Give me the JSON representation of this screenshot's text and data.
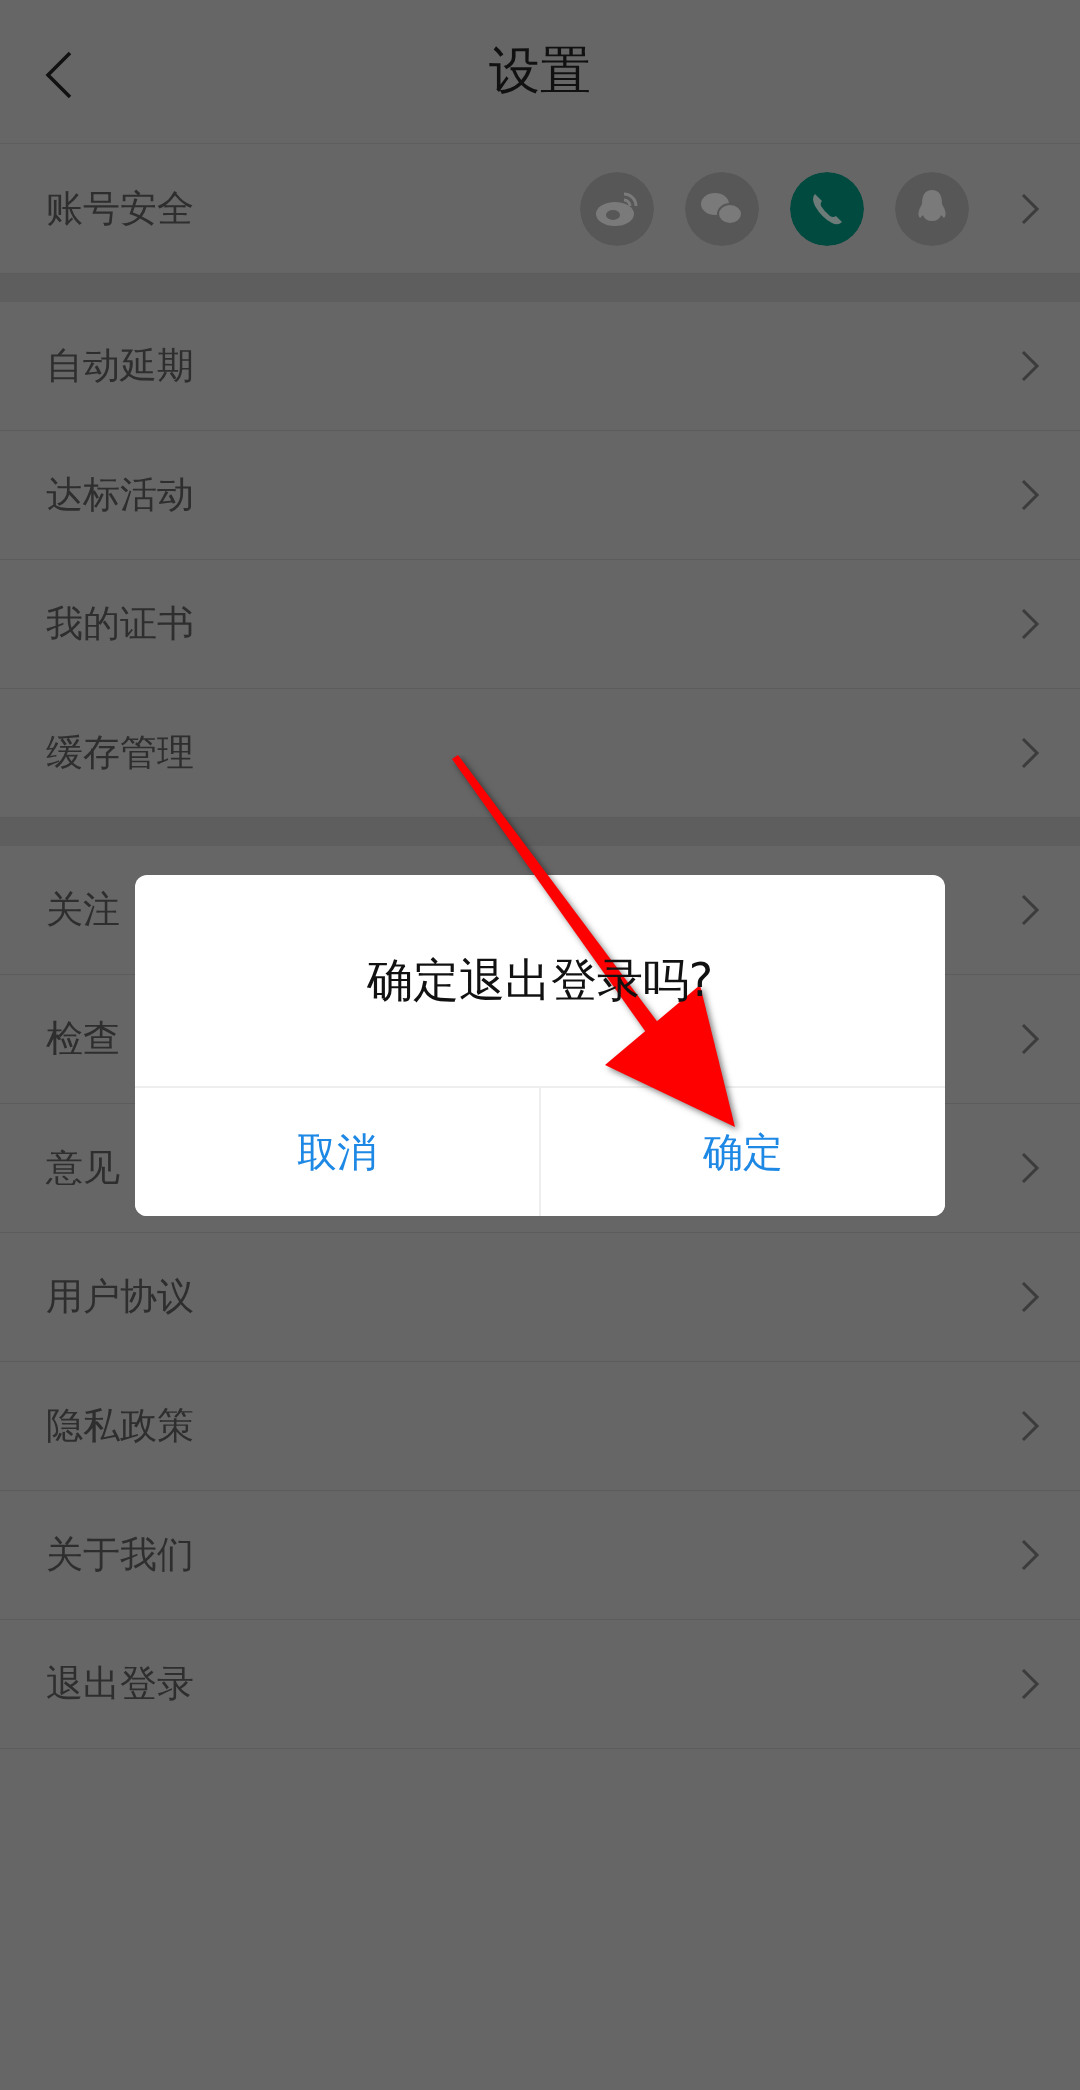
{
  "header": {
    "title": "设置"
  },
  "account": {
    "label": "账号安全",
    "links": [
      {
        "kind": "weibo",
        "bound": false
      },
      {
        "kind": "wechat",
        "bound": false
      },
      {
        "kind": "phone",
        "bound": true
      },
      {
        "kind": "qq",
        "bound": false
      }
    ]
  },
  "groups": [
    {
      "items": [
        {
          "label": "自动延期"
        },
        {
          "label": "达标活动"
        },
        {
          "label": "我的证书"
        },
        {
          "label": "缓存管理"
        }
      ]
    },
    {
      "items": [
        {
          "label": "关注"
        },
        {
          "label": "检查"
        },
        {
          "label": "意见"
        },
        {
          "label": "用户协议"
        },
        {
          "label": "隐私政策"
        },
        {
          "label": "关于我们"
        },
        {
          "label": "退出登录"
        }
      ]
    }
  ],
  "dialog": {
    "message": "确定退出登录吗?",
    "buttons": [
      {
        "label": "取消"
      },
      {
        "label": "确定"
      }
    ]
  }
}
